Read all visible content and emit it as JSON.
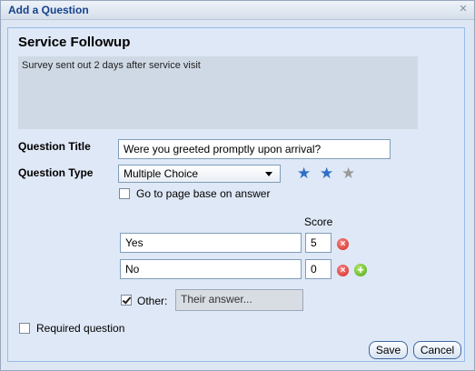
{
  "window": {
    "title": "Add a Question"
  },
  "survey": {
    "title": "Service Followup",
    "description": "Survey sent out 2 days after service visit"
  },
  "question": {
    "title_label": "Question Title",
    "title_value": "Were you greeted promptly upon arrival?",
    "type_label": "Question Type",
    "type_value": "Multiple Choice",
    "stars": {
      "filled": 2,
      "total": 3
    },
    "page_base_label": "Go to page base on answer"
  },
  "answers": {
    "score_header": "Score",
    "rows": [
      {
        "text": "Yes",
        "score": "5"
      },
      {
        "text": "No",
        "score": "0"
      }
    ],
    "other_label": "Other:",
    "other_placeholder": "Their answer..."
  },
  "required_label": "Required question",
  "buttons": {
    "save": "Save",
    "cancel": "Cancel"
  },
  "colors": {
    "star_filled": "#2f6fc8",
    "star_empty": "#9a9a9a",
    "title_text": "#15428b"
  }
}
